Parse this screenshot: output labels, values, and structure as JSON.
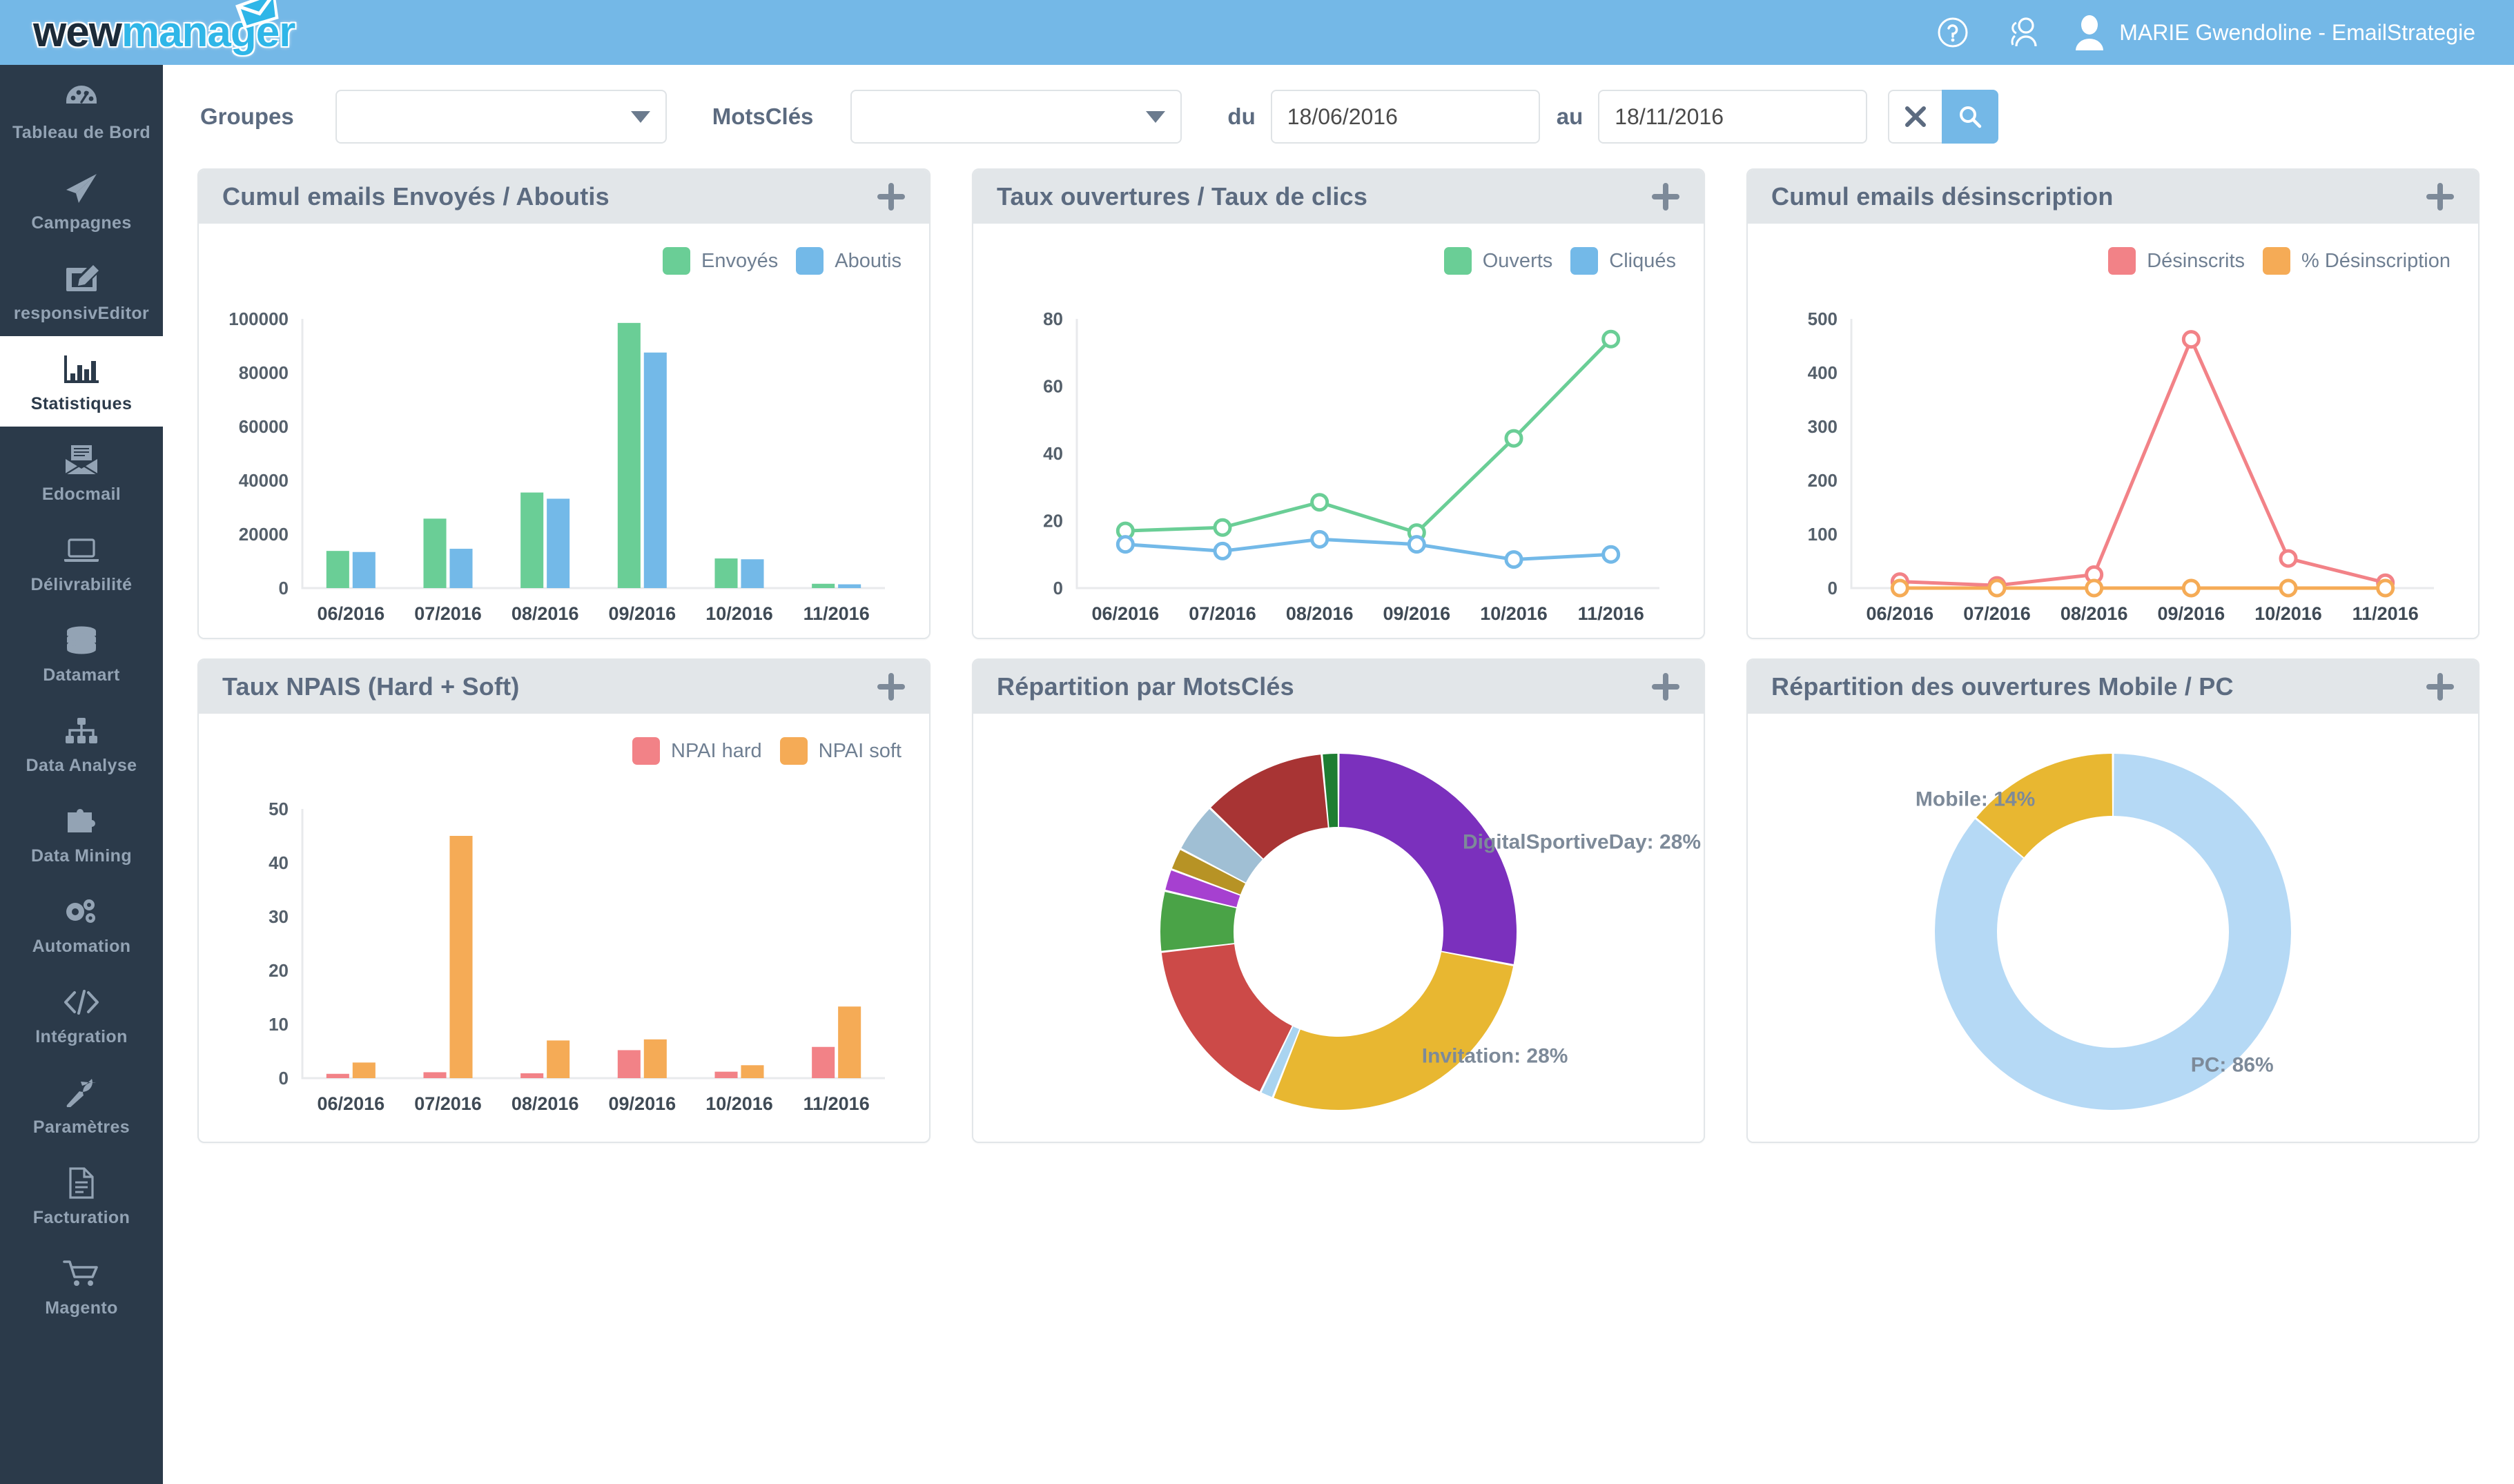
{
  "app": {
    "logo_part1": "wew",
    "logo_part2": "manager",
    "logo_envelope_icon": "envelope-icon"
  },
  "topbar": {
    "help_icon": "help-circle-icon",
    "users_icon": "users-icon",
    "avatar_icon": "user-avatar-icon",
    "user_name": "MARIE Gwendoline - EmailStrategie",
    "background": "#74b8e7"
  },
  "sidebar": {
    "background": "#2b3a4a",
    "items": [
      {
        "label": "Tableau de Bord",
        "icon": "dashboard-gauge-icon",
        "active": false
      },
      {
        "label": "Campagnes",
        "icon": "paper-plane-icon",
        "active": false
      },
      {
        "label": "responsivEditor",
        "icon": "edit-pencil-icon",
        "active": false
      },
      {
        "label": "Statistiques",
        "icon": "bar-chart-icon",
        "active": true
      },
      {
        "label": "Edocmail",
        "icon": "open-envelope-document-icon",
        "active": false
      },
      {
        "label": "Délivrabilité",
        "icon": "laptop-icon",
        "active": false
      },
      {
        "label": "Datamart",
        "icon": "database-icon",
        "active": false
      },
      {
        "label": "Data Analyse",
        "icon": "sitemap-icon",
        "active": false
      },
      {
        "label": "Data Mining",
        "icon": "puzzle-piece-icon",
        "active": false
      },
      {
        "label": "Automation",
        "icon": "gears-icon",
        "active": false
      },
      {
        "label": "Intégration",
        "icon": "code-brackets-icon",
        "active": false
      },
      {
        "label": "Paramètres",
        "icon": "wrench-icon",
        "active": false
      },
      {
        "label": "Facturation",
        "icon": "document-icon",
        "active": false
      },
      {
        "label": "Magento",
        "icon": "shopping-cart-icon",
        "active": false
      }
    ]
  },
  "filters": {
    "groupes_label": "Groupes",
    "groupes_value": "",
    "motscles_label": "MotsClés",
    "motscles_value": "",
    "du_label": "du",
    "date_from": "18/06/2016",
    "au_label": "au",
    "date_to": "18/11/2016",
    "clear_icon": "close-x-icon",
    "search_icon": "magnifier-icon",
    "dropdown_icon": "chevron-down-icon",
    "search_button_color": "#74b8e7"
  },
  "cards": {
    "expand_icon": "plus-icon",
    "c1_title": "Cumul emails Envoyés / Aboutis",
    "c2_title": "Taux ouvertures / Taux de clics",
    "c3_title": "Cumul emails désinscription",
    "c4_title": "Taux NPAIS (Hard + Soft)",
    "c5_title": "Répartition par MotsClés",
    "c6_title": "Répartition des ouvertures Mobile / PC"
  },
  "chart_data": [
    {
      "id": "cumul-envoyes-aboutis",
      "type": "bar",
      "title": "Cumul emails Envoyés / Aboutis",
      "categories": [
        "06/2016",
        "07/2016",
        "08/2016",
        "09/2016",
        "10/2016",
        "11/2016"
      ],
      "series": [
        {
          "name": "Envoyés",
          "color": "#6ace96",
          "values": [
            13800,
            25800,
            35500,
            98500,
            11000,
            1600
          ]
        },
        {
          "name": "Aboutis",
          "color": "#73b9e8",
          "values": [
            13400,
            14600,
            33200,
            87500,
            10700,
            1400
          ]
        }
      ],
      "ylabel": "",
      "xlabel": "",
      "yticks": [
        0,
        20000,
        40000,
        60000,
        80000,
        100000
      ],
      "ylim": [
        0,
        100000
      ],
      "grid": false,
      "legend_position": "top-right"
    },
    {
      "id": "taux-ouvertures-clics",
      "type": "line",
      "title": "Taux ouvertures / Taux de clics",
      "categories": [
        "06/2016",
        "07/2016",
        "08/2016",
        "09/2016",
        "10/2016",
        "11/2016"
      ],
      "series": [
        {
          "name": "Ouverts",
          "color": "#6ace96",
          "values": [
            17,
            18,
            25.5,
            16.5,
            44.5,
            74
          ]
        },
        {
          "name": "Cliqués",
          "color": "#73b9e8",
          "values": [
            13,
            11,
            14.5,
            13,
            8.5,
            10
          ]
        }
      ],
      "ylabel": "",
      "xlabel": "",
      "yticks": [
        0,
        20,
        40,
        60,
        80
      ],
      "ylim": [
        0,
        80
      ],
      "grid": false,
      "legend_position": "top-right"
    },
    {
      "id": "cumul-desinscription",
      "type": "line",
      "title": "Cumul emails désinscription",
      "categories": [
        "06/2016",
        "07/2016",
        "08/2016",
        "09/2016",
        "10/2016",
        "11/2016"
      ],
      "series": [
        {
          "name": "Désinscrits",
          "color": "#f28287",
          "values": [
            12,
            5,
            25,
            462,
            55,
            10
          ]
        },
        {
          "name": "% Désinscription",
          "color": "#f5ab56",
          "values": [
            0,
            0,
            0,
            0,
            0,
            0
          ]
        }
      ],
      "ylabel": "",
      "xlabel": "",
      "yticks": [
        0,
        100,
        200,
        300,
        400,
        500
      ],
      "ylim": [
        0,
        500
      ],
      "grid": false,
      "legend_position": "top-right"
    },
    {
      "id": "taux-npais",
      "type": "bar",
      "title": "Taux NPAIS (Hard + Soft)",
      "categories": [
        "06/2016",
        "07/2016",
        "08/2016",
        "09/2016",
        "10/2016",
        "11/2016"
      ],
      "series": [
        {
          "name": "NPAI hard",
          "color": "#f28287",
          "values": [
            0.8,
            1.1,
            0.9,
            5.2,
            1.2,
            5.8
          ]
        },
        {
          "name": "NPAI soft",
          "color": "#f5ab56",
          "values": [
            2.9,
            45,
            7,
            7.2,
            2.4,
            13.3
          ]
        }
      ],
      "ylabel": "",
      "xlabel": "",
      "yticks": [
        0,
        10,
        20,
        30,
        40,
        50
      ],
      "ylim": [
        0,
        50
      ],
      "grid": false,
      "legend_position": "top-right"
    },
    {
      "id": "repartition-motscles",
      "type": "pie",
      "title": "Répartition par MotsClés",
      "labels": [
        "DigitalSportiveDay: 28%",
        "Invitation: 28%"
      ],
      "slices": [
        {
          "name": "DigitalSportiveDay",
          "percent": 28,
          "color": "#7b30bd",
          "label": "DigitalSportiveDay: 28%"
        },
        {
          "name": "Invitation",
          "percent": 28,
          "color": "#e8b731",
          "label": "Invitation: 28%"
        },
        {
          "name": "slice-3",
          "percent": 1.2,
          "color": "#aad4f0",
          "label": ""
        },
        {
          "name": "slice-4",
          "percent": 16,
          "color": "#cc4a48",
          "label": ""
        },
        {
          "name": "slice-5",
          "percent": 5.5,
          "color": "#4aa347",
          "label": ""
        },
        {
          "name": "slice-6",
          "percent": 2,
          "color": "#a640d0",
          "label": ""
        },
        {
          "name": "slice-7",
          "percent": 2,
          "color": "#b79325",
          "label": ""
        },
        {
          "name": "slice-8",
          "percent": 4.5,
          "color": "#a0bfd4",
          "label": ""
        },
        {
          "name": "slice-9",
          "percent": 11.3,
          "color": "#a83434",
          "label": ""
        },
        {
          "name": "slice-10",
          "percent": 1.5,
          "color": "#1e7d32",
          "label": ""
        }
      ]
    },
    {
      "id": "repartition-mobile-pc",
      "type": "pie",
      "title": "Répartition des ouvertures Mobile / PC",
      "labels": [
        "PC: 86%",
        "Mobile: 14%"
      ],
      "slices": [
        {
          "name": "PC",
          "percent": 86,
          "color": "#b5d9f5",
          "label": "PC: 86%"
        },
        {
          "name": "Mobile",
          "percent": 14,
          "color": "#e8b731",
          "label": "Mobile: 14%"
        }
      ]
    }
  ]
}
